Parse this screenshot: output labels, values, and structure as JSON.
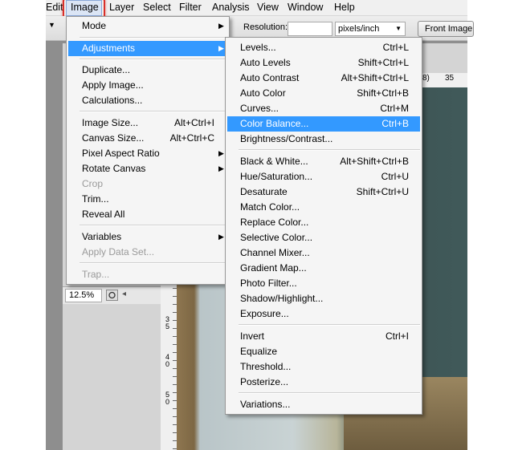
{
  "menubar": {
    "edit": "Edit",
    "image": "Image",
    "layer": "Layer",
    "select": "Select",
    "filter": "Filter",
    "analysis": "Analysis",
    "view": "View",
    "window": "Window",
    "help": "Help"
  },
  "options_bar": {
    "resolution_label": "Resolution:",
    "resolution_value": "",
    "unit_value": "pixels/inch",
    "front_image_label": "Front Image"
  },
  "image_menu": {
    "mode": "Mode",
    "adjustments": "Adjustments",
    "duplicate": "Duplicate...",
    "apply_image": "Apply Image...",
    "calculations": "Calculations...",
    "image_size": "Image Size...",
    "image_size_sc": "Alt+Ctrl+I",
    "canvas_size": "Canvas Size...",
    "canvas_size_sc": "Alt+Ctrl+C",
    "pixel_aspect": "Pixel Aspect Ratio",
    "rotate_canvas": "Rotate Canvas",
    "crop": "Crop",
    "trim": "Trim...",
    "reveal_all": "Reveal All",
    "variables": "Variables",
    "apply_data_set": "Apply Data Set...",
    "trap": "Trap..."
  },
  "adjustments_menu": {
    "levels": "Levels...",
    "levels_sc": "Ctrl+L",
    "auto_levels": "Auto Levels",
    "auto_levels_sc": "Shift+Ctrl+L",
    "auto_contrast": "Auto Contrast",
    "auto_contrast_sc": "Alt+Shift+Ctrl+L",
    "auto_color": "Auto Color",
    "auto_color_sc": "Shift+Ctrl+B",
    "curves": "Curves...",
    "curves_sc": "Ctrl+M",
    "color_balance": "Color Balance...",
    "color_balance_sc": "Ctrl+B",
    "brightness_contrast": "Brightness/Contrast...",
    "black_white": "Black & White...",
    "black_white_sc": "Alt+Shift+Ctrl+B",
    "hue_saturation": "Hue/Saturation...",
    "hue_saturation_sc": "Ctrl+U",
    "desaturate": "Desaturate",
    "desaturate_sc": "Shift+Ctrl+U",
    "match_color": "Match Color...",
    "replace_color": "Replace Color...",
    "selective_color": "Selective Color...",
    "channel_mixer": "Channel Mixer...",
    "gradient_map": "Gradient Map...",
    "photo_filter": "Photo Filter...",
    "shadow_highlight": "Shadow/Highlight...",
    "exposure": "Exposure...",
    "invert": "Invert",
    "invert_sc": "Ctrl+I",
    "equalize": "Equalize",
    "threshold": "Threshold...",
    "posterize": "Posterize...",
    "variations": "Variations..."
  },
  "status": {
    "zoom": "12.5%"
  },
  "rulers": {
    "h_35": "35",
    "h_paren": "8)",
    "v_3": "3",
    "v_5a": "5",
    "v_4": "4",
    "v_0": "0",
    "v_5b": "5",
    "v_0b": "0"
  },
  "colors": {
    "highlight": "#3399ff",
    "callout": "#d9302b",
    "menu_bg": "#f5f5f5"
  }
}
